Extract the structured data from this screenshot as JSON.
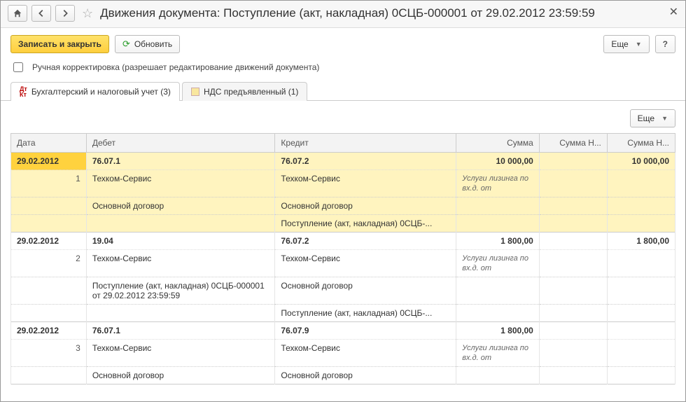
{
  "title": "Движения документа: Поступление (акт, накладная) 0СЦБ-000001 от 29.02.2012 23:59:59",
  "toolbar": {
    "save_close": "Записать и закрыть",
    "refresh": "Обновить",
    "more": "Еще",
    "help": "?"
  },
  "manual_edit_label": "Ручная корректировка (разрешает редактирование движений документа)",
  "tabs": {
    "accounting": "Бухгалтерский и налоговый учет (3)",
    "vat": "НДС предъявленный (1)"
  },
  "sub_more": "Еще",
  "columns": {
    "date": "Дата",
    "debit": "Дебет",
    "credit": "Кредит",
    "sum": "Сумма",
    "sumN1": "Сумма Н...",
    "sumN2": "Сумма Н..."
  },
  "rows": [
    {
      "n": "1",
      "date": "29.02.2012",
      "debit_acc": "76.07.1",
      "credit_acc": "76.07.2",
      "sum": "10 000,00",
      "sumN2": "10 000,00",
      "debit_lines": [
        "Техком-Сервис",
        "Основной договор"
      ],
      "credit_lines": [
        "Техком-Сервис",
        "Основной договор",
        "Поступление (акт, накладная) 0СЦБ-..."
      ],
      "note": "Услуги лизинга по вх.д.  от",
      "selected": true
    },
    {
      "n": "2",
      "date": "29.02.2012",
      "debit_acc": "19.04",
      "credit_acc": "76.07.2",
      "sum": "1 800,00",
      "sumN2": "1 800,00",
      "debit_lines": [
        "Техком-Сервис",
        "Поступление (акт, накладная) 0СЦБ-000001 от 29.02.2012 23:59:59"
      ],
      "credit_lines": [
        "Техком-Сервис",
        "Основной договор",
        "Поступление (акт, накладная) 0СЦБ-..."
      ],
      "note": "Услуги лизинга по вх.д.  от",
      "selected": false
    },
    {
      "n": "3",
      "date": "29.02.2012",
      "debit_acc": "76.07.1",
      "credit_acc": "76.07.9",
      "sum": "1 800,00",
      "sumN2": "",
      "debit_lines": [
        "Техком-Сервис",
        "Основной договор"
      ],
      "credit_lines": [
        "Техком-Сервис",
        "Основной договор"
      ],
      "note": "Услуги лизинга по вх.д.  от",
      "selected": false
    }
  ]
}
